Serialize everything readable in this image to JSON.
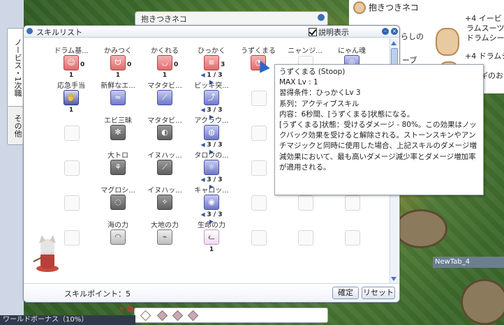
{
  "background_windows": {
    "top_center_title": "抱きつきネコ",
    "right_panel": {
      "title": "抱きつきネコ",
      "lines": [
        "+4 イービ",
        "ラムスーツ",
        "ドラムシー",
        "+4 ドラムシ",
        "ウサギのお"
      ],
      "mid_items": [
        "らしの",
        "ーブ"
      ]
    },
    "new_tab": "NewTab_4",
    "bottom_strip": "ワールドボーナス（10%）"
  },
  "side_tabs": [
    {
      "label": "ノービス・1次職"
    },
    {
      "label": "その他"
    }
  ],
  "skill_window": {
    "title": "スキルリスト",
    "desc_toggle_label": "説明表示",
    "skill_points_label": "スキルポイント：5",
    "confirm_label": "確定",
    "reset_label": "リセット",
    "skills": [
      {
        "id": "drum",
        "name": "ドラム基...",
        "style": "red",
        "glyph": "☺",
        "level": "1",
        "side": "0",
        "col": 0,
        "row": 0
      },
      {
        "id": "bite",
        "name": "かみつく",
        "style": "red",
        "glyph": "ᗢ",
        "level": "1",
        "side": "0",
        "col": 1,
        "row": 0
      },
      {
        "id": "hide",
        "name": "かくれる",
        "style": "red",
        "glyph": "◡",
        "level": "1",
        "side": "0",
        "col": 2,
        "row": 0
      },
      {
        "id": "scratch",
        "name": "ひっかく",
        "style": "red",
        "glyph": "≋",
        "level": "1 / 3",
        "side": "3",
        "arrows": true,
        "col": 3,
        "row": 0
      },
      {
        "id": "stoop",
        "name": "うずくまる",
        "style": "red",
        "glyph": "◔",
        "level": "",
        "col": 4,
        "row": 0
      },
      {
        "id": "nyanj",
        "name": "ニャンジ...",
        "style": "empty",
        "col": 5,
        "row": 0
      },
      {
        "id": "nyansoul",
        "name": "にゃん魂",
        "style": "blue",
        "glyph": "◎",
        "col": 6,
        "row": 0
      },
      {
        "id": "emergency",
        "name": "応急手当",
        "style": "hand",
        "glyph": "✋",
        "level": "1",
        "col": 0,
        "row": 1
      },
      {
        "id": "fresh",
        "name": "新鮮なエ...",
        "style": "blue",
        "glyph": "≈",
        "col": 1,
        "row": 1
      },
      {
        "id": "matatabi1",
        "name": "マタタビ...",
        "style": "blue",
        "glyph": "⟋",
        "col": 2,
        "row": 1
      },
      {
        "id": "pikki",
        "name": "ピッキ突...",
        "style": "blue",
        "glyph": "⤴",
        "level": "3 / 3",
        "arrows": true,
        "col": 3,
        "row": 1
      },
      {
        "id": "e1",
        "name": "",
        "style": "empty",
        "col": 4,
        "row": 1
      },
      {
        "id": "shrimp",
        "name": "エビ三昧",
        "style": "gray",
        "glyph": "✻",
        "col": 1,
        "row": 2
      },
      {
        "id": "matatabi2",
        "name": "マタタビ...",
        "style": "gray",
        "glyph": "◐",
        "col": 2,
        "row": 2
      },
      {
        "id": "arclouse",
        "name": "アクラウ...",
        "style": "blue",
        "glyph": "◍",
        "level": "3 / 3",
        "arrows": true,
        "col": 3,
        "row": 2
      },
      {
        "id": "tuna",
        "name": "大トロ",
        "style": "gray",
        "glyph": "⚘",
        "col": 1,
        "row": 3
      },
      {
        "id": "isuha1",
        "name": "イヌハッ...",
        "style": "gray",
        "glyph": "⟋",
        "col": 2,
        "row": 3
      },
      {
        "id": "taro",
        "name": "タロウの...",
        "style": "blue",
        "glyph": "☼",
        "level": "3 / 3",
        "arrows": true,
        "col": 3,
        "row": 3
      },
      {
        "id": "maguro",
        "name": "マグロシ...",
        "style": "gray",
        "glyph": "◌",
        "col": 1,
        "row": 4
      },
      {
        "id": "isuha2",
        "name": "イヌハッ...",
        "style": "gray",
        "glyph": "✧",
        "col": 2,
        "row": 4
      },
      {
        "id": "carrot",
        "name": "キャロッ...",
        "style": "blue",
        "glyph": "◉",
        "level": "3 / 3",
        "arrows": true,
        "col": 3,
        "row": 4
      },
      {
        "id": "sea",
        "name": "海の力",
        "style": "earth",
        "glyph": "◠",
        "col": 1,
        "row": 5
      },
      {
        "id": "earth",
        "name": "大地の力",
        "style": "earth",
        "glyph": "⌁",
        "col": 2,
        "row": 5
      },
      {
        "id": "life",
        "name": "生命の力",
        "style": "cat",
        "glyph": "ᓚ",
        "level": "1",
        "col": 3,
        "row": 5
      }
    ]
  },
  "tooltip": {
    "header": "うずくまる (Stoop)",
    "max_lv": "MAX Lv : 1",
    "requirement": "習得条件：ひっかくLv 3",
    "type": "系列：アクティブスキル",
    "content": "内容：6秒間、[うずくまる]状態になる。",
    "effect": "[うずくまる]状態：受けるダメージ - 80%。この効果はノックバック効果を受けると解除される。ストーンスキンやアンチマジックと同時に使用した場合、上記スキルのダメージ増減効果において、最も高いダメージ減少率とダメージ増加率が適用される。"
  }
}
